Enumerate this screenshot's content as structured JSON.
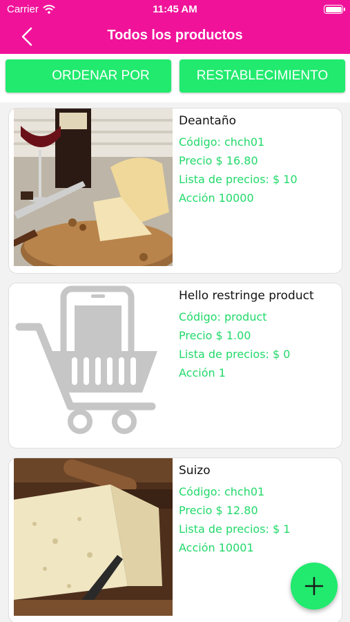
{
  "status_bar": {
    "carrier": "Carrier",
    "time": "11:45 AM"
  },
  "nav": {
    "title": "Todos los productos",
    "back_icon": "chevron-left-icon"
  },
  "toolbar": {
    "sort_label": "ORDENAR POR",
    "reset_label": "RESTABLECIMIENTO"
  },
  "colors": {
    "header": "#f0139a",
    "accent": "#21ea6e",
    "detail_text": "#21d96a"
  },
  "products": [
    {
      "name": "Deantaño",
      "code": "Código: chch01",
      "price": "Precio $ 16.80",
      "price_list": "Lista de precios: $ 10",
      "action": "Acción 10000",
      "image": "wine-and-cheese-photo"
    },
    {
      "name": "Hello restringe product",
      "code": "Código: product",
      "price": "Precio $ 1.00",
      "price_list": "Lista de precios: $ 0",
      "action": "Acción 1",
      "image": "shopping-cart-placeholder-icon"
    },
    {
      "name": "Suizo",
      "code": "Código: chch01",
      "price": "Precio $ 12.80",
      "price_list": "Lista de precios: $ 1",
      "action": "Acción 10001",
      "image": "swiss-cheese-photo"
    }
  ],
  "fab": {
    "icon": "plus-icon"
  }
}
